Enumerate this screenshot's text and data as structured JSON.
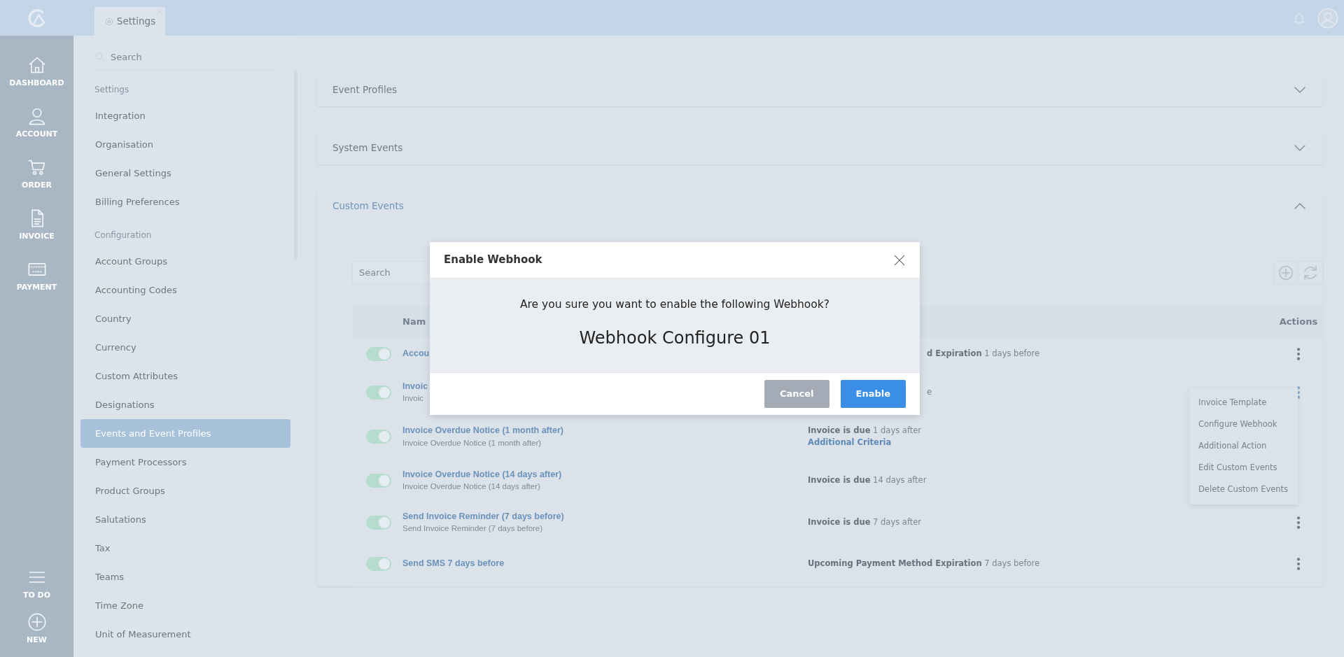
{
  "rail": {
    "items": [
      {
        "label": "DASHBOARD"
      },
      {
        "label": "ACCOUNT"
      },
      {
        "label": "ORDER"
      },
      {
        "label": "INVOICE"
      },
      {
        "label": "PAYMENT"
      }
    ],
    "bottom": [
      {
        "label": "TO DO"
      },
      {
        "label": "NEW"
      }
    ]
  },
  "tabs": [
    {
      "label": "Settings",
      "selected": true
    }
  ],
  "settings_nav": {
    "search_placeholder": "Search",
    "sections": [
      {
        "heading": "Settings",
        "items": [
          {
            "label": "Integration",
            "selected": false
          },
          {
            "label": "Organisation",
            "selected": false
          },
          {
            "label": "General Settings",
            "selected": false
          },
          {
            "label": "Billing Preferences",
            "selected": false
          }
        ]
      },
      {
        "heading": "Configuration",
        "items": [
          {
            "label": "Account Groups",
            "selected": false
          },
          {
            "label": "Accounting Codes",
            "selected": false
          },
          {
            "label": "Country",
            "selected": false
          },
          {
            "label": "Currency",
            "selected": false
          },
          {
            "label": "Custom Attributes",
            "selected": false
          },
          {
            "label": "Designations",
            "selected": false
          },
          {
            "label": "Events and Event Profiles",
            "selected": true
          },
          {
            "label": "Payment Processors",
            "selected": false
          },
          {
            "label": "Product Groups",
            "selected": false
          },
          {
            "label": "Salutations",
            "selected": false
          },
          {
            "label": "Tax",
            "selected": false
          },
          {
            "label": "Teams",
            "selected": false
          },
          {
            "label": "Time Zone",
            "selected": false
          },
          {
            "label": "Unit of Measurement",
            "selected": false
          }
        ]
      }
    ]
  },
  "accordions": [
    {
      "title": "Event Profiles",
      "expanded": false
    },
    {
      "title": "System Events",
      "expanded": false
    },
    {
      "title": "Custom Events",
      "expanded": true
    }
  ],
  "custom_events": {
    "search_placeholder": "Search",
    "columns": [
      "Nam",
      "Actions"
    ],
    "rows": [
      {
        "on": true,
        "name": "Accou",
        "condition_bold": "d Expiration",
        "condition": "1 days before",
        "actions_icon": true,
        "menu_open": false
      },
      {
        "on": true,
        "name": "Invoic",
        "subtitle": "Invoic",
        "condition_tail": "e",
        "actions_icon": true,
        "menu_open": true
      },
      {
        "on": true,
        "name": "Invoice Overdue Notice (1 month after)",
        "subtitle": "Invoice Overdue Notice (1 month after)",
        "condition_bold": "Invoice is due",
        "condition": "1 days after",
        "link": "Additional Criteria",
        "actions_icon": false,
        "menu_open": false
      },
      {
        "on": true,
        "name": "Invoice Overdue Notice (14 days after)",
        "subtitle": "Invoice Overdue Notice (14 days after)",
        "condition_bold": "Invoice is due",
        "condition": "14 days after",
        "actions_icon": false,
        "menu_open": false
      },
      {
        "on": true,
        "name": "Send Invoice Reminder (7 days before)",
        "subtitle": "Send Invoice Reminder (7 days before)",
        "condition_bold": "Invoice is due",
        "condition": "7 days after",
        "actions_icon": true,
        "menu_open": false
      },
      {
        "on": true,
        "name": "Send SMS 7 days before",
        "condition_bold": "Upcoming Payment Method Expiration",
        "condition": "7 days before",
        "actions_icon": true,
        "menu_open": false
      }
    ],
    "menu": [
      "Invoice Template",
      "Configure Webhook",
      "Additional Action",
      "Edit Custom Events",
      "Delete Custom Events"
    ]
  },
  "modal": {
    "title": "Enable Webhook",
    "message": "Are you sure you want to enable the following Webhook?",
    "subject": "Webhook Configure 01",
    "buttons": [
      {
        "label": "Cancel",
        "kind": "secondary"
      },
      {
        "label": "Enable",
        "kind": "primary"
      }
    ]
  }
}
